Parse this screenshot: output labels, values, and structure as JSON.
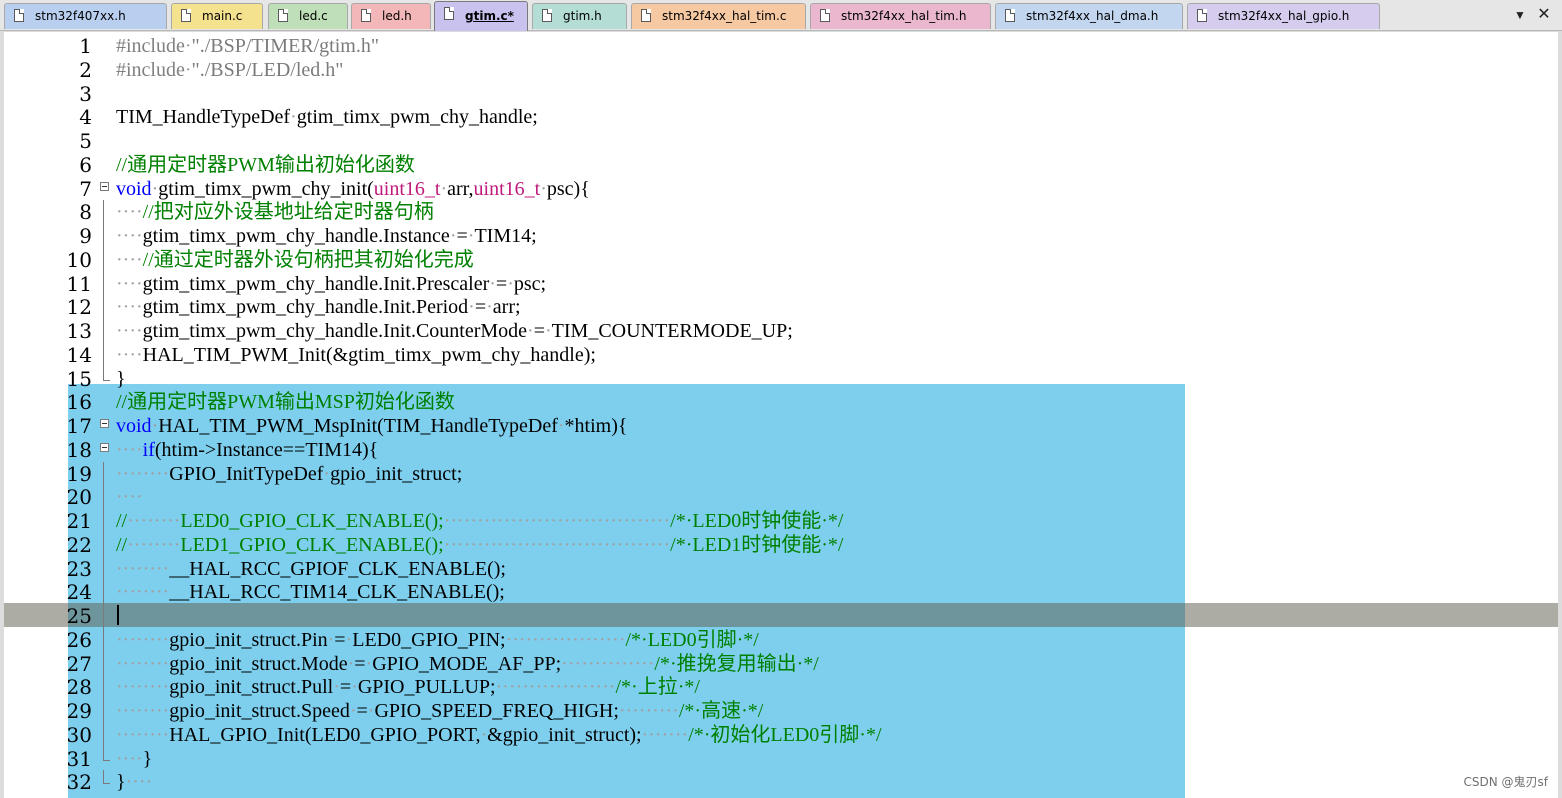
{
  "tabs": [
    {
      "label": "stm32f407xx.h",
      "color": "#b9cff0",
      "active": false
    },
    {
      "label": "main.c",
      "color": "#f5e28e",
      "active": false
    },
    {
      "label": "led.c",
      "color": "#bedfb7",
      "active": false
    },
    {
      "label": "led.h",
      "color": "#f3b7b9",
      "active": false
    },
    {
      "label": "gtim.c*",
      "color": "#c9c1ee",
      "active": true
    },
    {
      "label": "gtim.h",
      "color": "#b4ddd5",
      "active": false
    },
    {
      "label": "stm32f4xx_hal_tim.c",
      "color": "#f7c9a3",
      "active": false
    },
    {
      "label": "stm32f4xx_hal_tim.h",
      "color": "#eab7cf",
      "active": false
    },
    {
      "label": "stm32f4xx_hal_dma.h",
      "color": "#c3d6ef",
      "active": false
    },
    {
      "label": "stm32f4xx_hal_gpio.h",
      "color": "#d5ccee",
      "active": false
    }
  ],
  "tab_controls": {
    "menu_glyph": "▼",
    "close_glyph": "✕"
  },
  "icons": {
    "tab_file": "document-icon",
    "fold_open": "fold-minus-icon",
    "fold_end": "fold-end-icon"
  },
  "colors": {
    "selection": "#7ecfee",
    "keyword": "#0000ff",
    "type": "#c0197c",
    "comment": "#008000",
    "preprocessor": "#808080"
  },
  "editor": {
    "current_line": 25,
    "selection_range": [
      16,
      32
    ],
    "lines": [
      {
        "n": "1",
        "fold": "",
        "t": [
          [
            "pp",
            "#include"
          ],
          [
            "ws",
            "·"
          ],
          [
            "pst",
            "\"./BSP/TIMER/gtim.h\""
          ]
        ]
      },
      {
        "n": "2",
        "fold": "",
        "t": [
          [
            "pp",
            "#include"
          ],
          [
            "ws",
            "·"
          ],
          [
            "pst",
            "\"./BSP/LED/led.h\""
          ]
        ]
      },
      {
        "n": "3",
        "fold": "",
        "t": []
      },
      {
        "n": "4",
        "fold": "",
        "t": [
          [
            "id",
            "TIM_HandleTypeDef"
          ],
          [
            "ws",
            "·"
          ],
          [
            "id",
            "gtim_timx_pwm_chy_handle;"
          ]
        ]
      },
      {
        "n": "5",
        "fold": "",
        "t": []
      },
      {
        "n": "6",
        "fold": "",
        "t": [
          [
            "cm",
            "//通用定时器PWM输出初始化函数"
          ]
        ]
      },
      {
        "n": "7",
        "fold": "open",
        "t": [
          [
            "kw",
            "void"
          ],
          [
            "ws",
            "·"
          ],
          [
            "id",
            "gtim_timx_pwm_chy_init("
          ],
          [
            "ty",
            "uint16_t"
          ],
          [
            "ws",
            "·"
          ],
          [
            "id",
            "arr,"
          ],
          [
            "ty",
            "uint16_t"
          ],
          [
            "ws",
            "·"
          ],
          [
            "id",
            "psc){"
          ]
        ]
      },
      {
        "n": "8",
        "fold": "line",
        "t": [
          [
            "ws",
            "····"
          ],
          [
            "cm",
            "//把对应外设基地址给定时器句柄"
          ]
        ]
      },
      {
        "n": "9",
        "fold": "line",
        "t": [
          [
            "ws",
            "····"
          ],
          [
            "id",
            "gtim_timx_pwm_chy_handle.Instance"
          ],
          [
            "ws",
            "·"
          ],
          [
            "op",
            "="
          ],
          [
            "ws",
            "·"
          ],
          [
            "id",
            "TIM14;"
          ]
        ]
      },
      {
        "n": "10",
        "fold": "line",
        "t": [
          [
            "ws",
            "····"
          ],
          [
            "cm",
            "//通过定时器外设句柄把其初始化完成"
          ]
        ]
      },
      {
        "n": "11",
        "fold": "line",
        "t": [
          [
            "ws",
            "····"
          ],
          [
            "id",
            "gtim_timx_pwm_chy_handle.Init.Prescaler"
          ],
          [
            "ws",
            "·"
          ],
          [
            "op",
            "="
          ],
          [
            "ws",
            "·"
          ],
          [
            "id",
            "psc;"
          ]
        ]
      },
      {
        "n": "12",
        "fold": "line",
        "t": [
          [
            "ws",
            "····"
          ],
          [
            "id",
            "gtim_timx_pwm_chy_handle.Init.Period"
          ],
          [
            "ws",
            "·"
          ],
          [
            "op",
            "="
          ],
          [
            "ws",
            "·"
          ],
          [
            "id",
            "arr;"
          ]
        ]
      },
      {
        "n": "13",
        "fold": "line",
        "t": [
          [
            "ws",
            "····"
          ],
          [
            "id",
            "gtim_timx_pwm_chy_handle.Init.CounterMode"
          ],
          [
            "ws",
            "·"
          ],
          [
            "op",
            "="
          ],
          [
            "ws",
            "·"
          ],
          [
            "id",
            "TIM_COUNTERMODE_UP;"
          ]
        ]
      },
      {
        "n": "14",
        "fold": "line",
        "t": [
          [
            "ws",
            "····"
          ],
          [
            "id",
            "HAL_TIM_PWM_Init(&gtim_timx_pwm_chy_handle);"
          ]
        ]
      },
      {
        "n": "15",
        "fold": "end",
        "t": [
          [
            "id",
            "}"
          ]
        ]
      },
      {
        "n": "16",
        "fold": "",
        "t": [
          [
            "cm",
            "//通用定时器PWM输出MSP初始化函数"
          ]
        ]
      },
      {
        "n": "17",
        "fold": "open",
        "t": [
          [
            "kw",
            "void"
          ],
          [
            "ws",
            "·"
          ],
          [
            "id",
            "HAL_TIM_PWM_MspInit(TIM_HandleTypeDef"
          ],
          [
            "ws",
            "·"
          ],
          [
            "id",
            "*htim){"
          ]
        ]
      },
      {
        "n": "18",
        "fold": "open",
        "t": [
          [
            "ws",
            "····"
          ],
          [
            "kw",
            "if"
          ],
          [
            "id",
            "(htim->Instance==TIM14){"
          ]
        ]
      },
      {
        "n": "19",
        "fold": "line",
        "t": [
          [
            "ws",
            "········"
          ],
          [
            "id",
            "GPIO_InitTypeDef"
          ],
          [
            "ws",
            "·"
          ],
          [
            "id",
            "gpio_init_struct;"
          ]
        ]
      },
      {
        "n": "20",
        "fold": "line",
        "t": [
          [
            "ws",
            "····"
          ]
        ]
      },
      {
        "n": "21",
        "fold": "line",
        "t": [
          [
            "cm",
            "//"
          ],
          [
            "ws",
            "········"
          ],
          [
            "cm",
            "LED0_GPIO_CLK_ENABLE();"
          ],
          [
            "ws",
            "··································"
          ],
          [
            "cm",
            "/*·LED0时钟使能·*/"
          ]
        ]
      },
      {
        "n": "22",
        "fold": "line",
        "t": [
          [
            "cm",
            "//"
          ],
          [
            "ws",
            "········"
          ],
          [
            "cm",
            "LED1_GPIO_CLK_ENABLE();"
          ],
          [
            "ws",
            "··································"
          ],
          [
            "cm",
            "/*·LED1时钟使能·*/"
          ]
        ]
      },
      {
        "n": "23",
        "fold": "line",
        "t": [
          [
            "ws",
            "········"
          ],
          [
            "id",
            "__HAL_RCC_GPIOF_CLK_ENABLE();"
          ]
        ]
      },
      {
        "n": "24",
        "fold": "line",
        "t": [
          [
            "ws",
            "········"
          ],
          [
            "id",
            "__HAL_RCC_TIM14_CLK_ENABLE();"
          ]
        ]
      },
      {
        "n": "25",
        "fold": "line",
        "t": []
      },
      {
        "n": "26",
        "fold": "line",
        "t": [
          [
            "ws",
            "········"
          ],
          [
            "id",
            "gpio_init_struct.Pin"
          ],
          [
            "ws",
            "·"
          ],
          [
            "op",
            "="
          ],
          [
            "ws",
            "·"
          ],
          [
            "id",
            "LED0_GPIO_PIN;"
          ],
          [
            "ws",
            "··················"
          ],
          [
            "cm",
            "/*·LED0引脚·*/"
          ]
        ]
      },
      {
        "n": "27",
        "fold": "line",
        "t": [
          [
            "ws",
            "········"
          ],
          [
            "id",
            "gpio_init_struct.Mode"
          ],
          [
            "ws",
            "·"
          ],
          [
            "op",
            "="
          ],
          [
            "ws",
            "·"
          ],
          [
            "id",
            "GPIO_MODE_AF_PP;"
          ],
          [
            "ws",
            "··············"
          ],
          [
            "cm",
            "/*·推挽复用输出·*/"
          ]
        ]
      },
      {
        "n": "28",
        "fold": "line",
        "t": [
          [
            "ws",
            "········"
          ],
          [
            "id",
            "gpio_init_struct.Pull"
          ],
          [
            "ws",
            "·"
          ],
          [
            "op",
            "="
          ],
          [
            "ws",
            "·"
          ],
          [
            "id",
            "GPIO_PULLUP;"
          ],
          [
            "ws",
            "··················"
          ],
          [
            "cm",
            "/*·上拉·*/"
          ]
        ]
      },
      {
        "n": "29",
        "fold": "line",
        "t": [
          [
            "ws",
            "········"
          ],
          [
            "id",
            "gpio_init_struct.Speed"
          ],
          [
            "ws",
            "·"
          ],
          [
            "op",
            "="
          ],
          [
            "ws",
            "·"
          ],
          [
            "id",
            "GPIO_SPEED_FREQ_HIGH;"
          ],
          [
            "ws",
            "·········"
          ],
          [
            "cm",
            "/*·高速·*/"
          ]
        ]
      },
      {
        "n": "30",
        "fold": "line",
        "t": [
          [
            "ws",
            "········"
          ],
          [
            "id",
            "HAL_GPIO_Init(LED0_GPIO_PORT,"
          ],
          [
            "ws",
            "·"
          ],
          [
            "id",
            "&gpio_init_struct);"
          ],
          [
            "ws",
            "·······"
          ],
          [
            "cm",
            "/*·初始化LED0引脚·*/"
          ]
        ]
      },
      {
        "n": "31",
        "fold": "end",
        "t": [
          [
            "ws",
            "····"
          ],
          [
            "id",
            "}"
          ]
        ]
      },
      {
        "n": "32",
        "fold": "end",
        "t": [
          [
            "id",
            "}"
          ],
          [
            "ws",
            "····"
          ]
        ]
      }
    ]
  },
  "watermark": "CSDN @鬼刃sf"
}
